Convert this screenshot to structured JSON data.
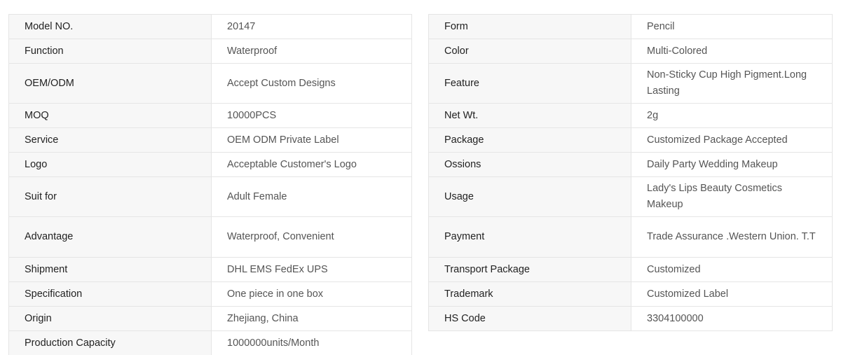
{
  "left_table": [
    {
      "label": "Model NO.",
      "value": "20147"
    },
    {
      "label": "Function",
      "value": "Waterproof"
    },
    {
      "label": "OEM/ODM",
      "value": "Accept Custom Designs"
    },
    {
      "label": "MOQ",
      "value": "10000PCS"
    },
    {
      "label": "Service",
      "value": "OEM ODM Private Label"
    },
    {
      "label": "Logo",
      "value": "Acceptable Customer's Logo"
    },
    {
      "label": "Suit for",
      "value": "Adult Female"
    },
    {
      "label": "Advantage",
      "value": "Waterproof, Convenient"
    },
    {
      "label": "Shipment",
      "value": "DHL EMS FedEx UPS"
    },
    {
      "label": "Specification",
      "value": "One piece in one box"
    },
    {
      "label": "Origin",
      "value": "Zhejiang, China"
    },
    {
      "label": "Production Capacity",
      "value": "1000000units/Month"
    }
  ],
  "right_table": [
    {
      "label": "Form",
      "value": "Pencil"
    },
    {
      "label": "Color",
      "value": "Multi-Colored"
    },
    {
      "label": "Feature",
      "value": "Non-Sticky Cup High Pigment.Long Lasting"
    },
    {
      "label": "Net Wt.",
      "value": "2g"
    },
    {
      "label": "Package",
      "value": "Customized Package Accepted"
    },
    {
      "label": "Ossions",
      "value": "Daily Party Wedding Makeup"
    },
    {
      "label": "Usage",
      "value": "Lady's Lips Beauty Cosmetics Makeup"
    },
    {
      "label": "Payment",
      "value": "Trade Assurance .Western Union. T.T"
    },
    {
      "label": "Transport Package",
      "value": "Customized"
    },
    {
      "label": "Trademark",
      "value": "Customized Label"
    },
    {
      "label": "HS Code",
      "value": "3304100000"
    }
  ]
}
